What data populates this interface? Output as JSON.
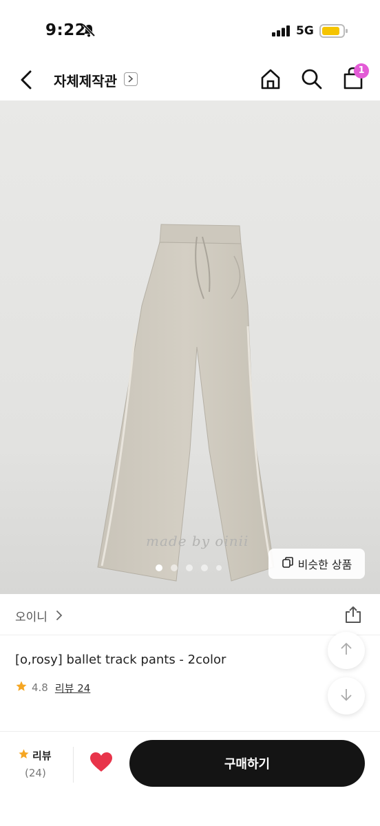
{
  "status_bar": {
    "time": "9:22",
    "network": "5G"
  },
  "nav": {
    "title": "자체제작관",
    "cart_count": "1"
  },
  "hero": {
    "watermark": "made by oinii",
    "similar_button_label": "비슷한 상품",
    "page_dots": 5,
    "active_dot": 1
  },
  "product": {
    "brand": "오이니",
    "title": "[o,rosy] ballet track pants - 2color",
    "rating": "4.8",
    "review_link": "리뷰 24"
  },
  "bottom_bar": {
    "review_label": "리뷰",
    "review_count": "(24)",
    "buy_label": "구매하기"
  },
  "colors": {
    "accent_star": "#f5a623",
    "heart": "#e8344a",
    "badge": "#e35bd6",
    "buy_button": "#141414"
  },
  "icons": [
    "bell-slash-icon",
    "signal-icon",
    "battery-icon",
    "back-icon",
    "chevron-right-icon",
    "home-icon",
    "search-icon",
    "cart-icon",
    "copy-icon",
    "share-icon",
    "arrow-up-icon",
    "arrow-down-icon",
    "star-icon",
    "heart-icon"
  ]
}
